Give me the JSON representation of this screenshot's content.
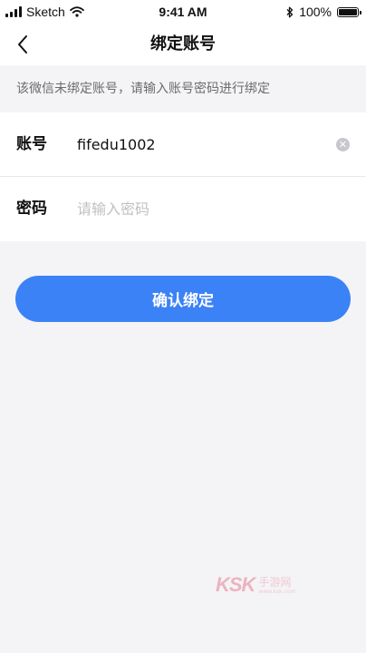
{
  "status_bar": {
    "carrier": "Sketch",
    "time": "9:41 AM",
    "battery": "100%"
  },
  "nav": {
    "title": "绑定账号"
  },
  "notice": {
    "text": "该微信未绑定账号，请输入账号密码进行绑定"
  },
  "form": {
    "account": {
      "label": "账号",
      "value": "fifedu1002"
    },
    "password": {
      "label": "密码",
      "placeholder": "请输入密码"
    }
  },
  "actions": {
    "confirm_label": "确认绑定"
  },
  "watermark": {
    "logo": "KSK",
    "text": "手游网",
    "url": "www.ksk.com"
  },
  "colors": {
    "accent": "#3b82f6",
    "background": "#f4f4f6"
  }
}
